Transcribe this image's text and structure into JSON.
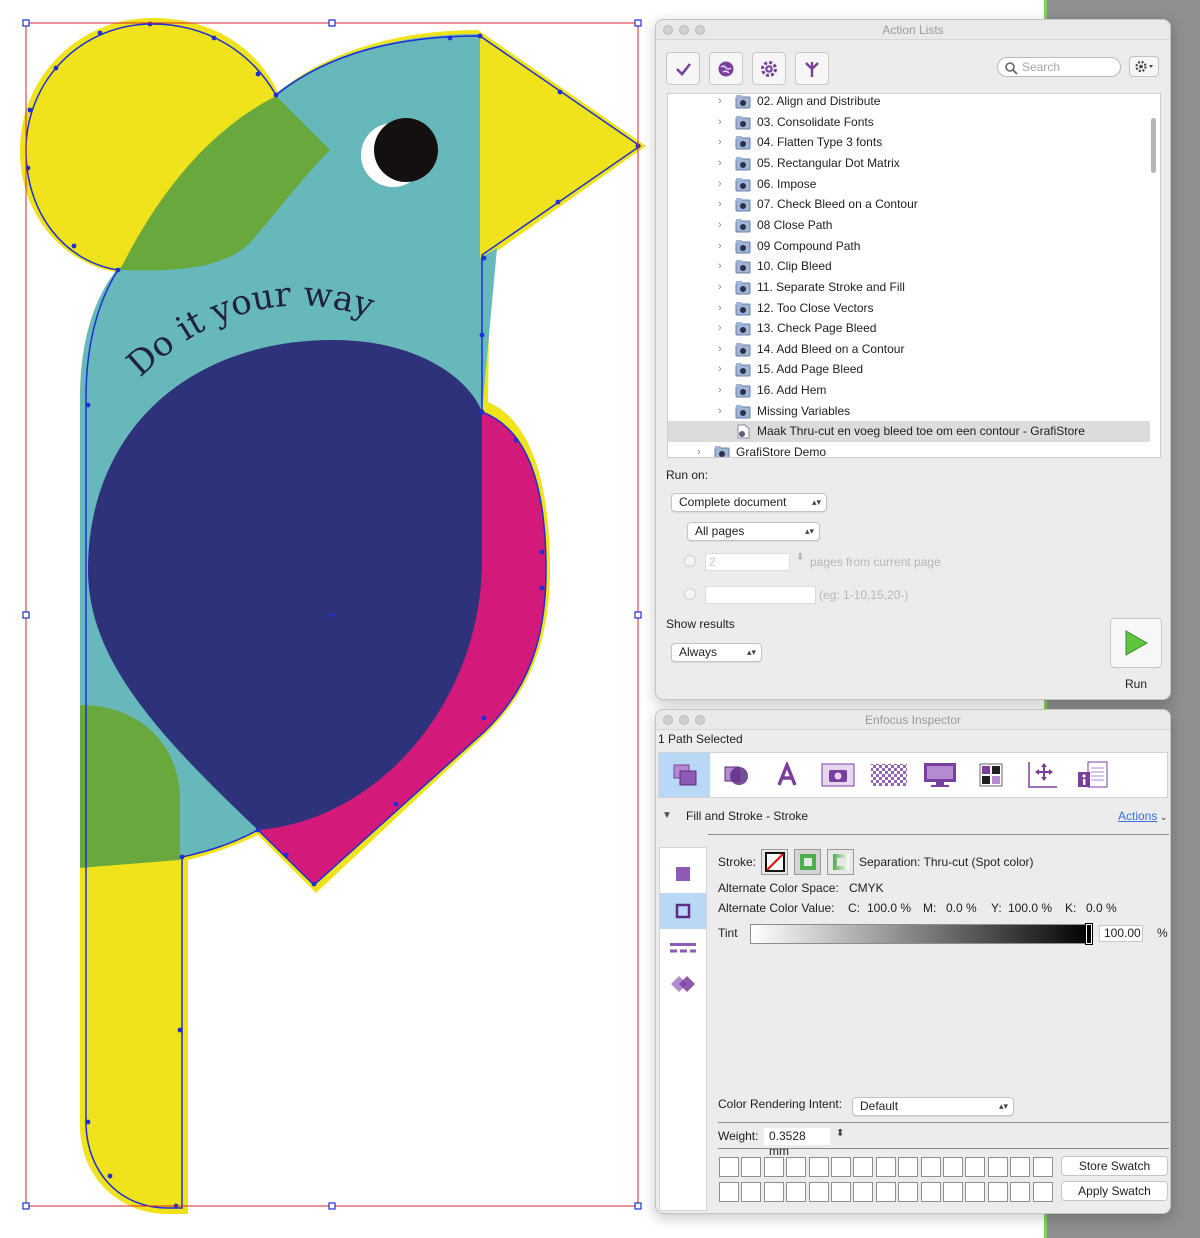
{
  "artwork": {
    "headline": "Do it your way",
    "colors": {
      "teal": "#67b8bb",
      "yellow": "#f0e31b",
      "green": "#68a83c",
      "navy": "#2d327a",
      "magenta": "#d31a7a",
      "selection_path": "#1d2fd6",
      "trim_box": "#d3262f"
    }
  },
  "action_lists": {
    "window_title": "Action Lists",
    "toolbar": {
      "buttons": [
        {
          "icon": "check-icon"
        },
        {
          "icon": "globe-icon"
        },
        {
          "icon": "gear-icon"
        },
        {
          "icon": "split-arrow-icon"
        }
      ],
      "search_placeholder": "Search",
      "options_icon": "gear-menu-icon"
    },
    "items": [
      {
        "label": "02. Align and Distribute"
      },
      {
        "label": "03. Consolidate Fonts"
      },
      {
        "label": "04. Flatten Type 3 fonts"
      },
      {
        "label": "05. Rectangular Dot Matrix"
      },
      {
        "label": "06. Impose"
      },
      {
        "label": "07. Check Bleed on a Contour"
      },
      {
        "label": "08 Close Path"
      },
      {
        "label": "09 Compound Path"
      },
      {
        "label": "10. Clip Bleed"
      },
      {
        "label": "11. Separate Stroke and Fill"
      },
      {
        "label": "12. Too Close Vectors"
      },
      {
        "label": "13. Check Page Bleed"
      },
      {
        "label": "14. Add Bleed on a Contour"
      },
      {
        "label": "15. Add Page Bleed"
      },
      {
        "label": "16. Add Hem"
      },
      {
        "label": "Missing Variables"
      }
    ],
    "selected_item": "Maak Thru-cut en voeg bleed toe om een contour - GrafiStore",
    "parent_folder": "GrafiStore Demo",
    "run_on_label": "Run on:",
    "run_on_value": "Complete document",
    "pages_value": "All pages",
    "pages_count": "2",
    "pages_from_current": "pages from current page",
    "page_range_hint": "(eg: 1-10,15,20-)",
    "show_results_label": "Show results",
    "show_results_value": "Always",
    "run_label": "Run"
  },
  "inspector": {
    "window_title": "Enfocus Inspector",
    "selection_status": "1 Path Selected",
    "tab_icons": [
      "fill-stroke-icon",
      "transparency-icon",
      "text-icon",
      "image-icon",
      "pattern-icon",
      "monitor-icon",
      "swatch-grid-icon",
      "position-icon",
      "document-info-icon"
    ],
    "section_title": "Fill and Stroke - Stroke",
    "actions_label": "Actions",
    "stroke_label": "Stroke:",
    "separation": "Separation: Thru-cut (Spot color)",
    "alt_space_label": "Alternate Color Space:",
    "alt_space_value": "CMYK",
    "alt_value_label": "Alternate Color Value:",
    "cmyk": {
      "c_label": "C:",
      "c": "100.0 %",
      "m_label": "M:",
      "m": "0.0 %",
      "y_label": "Y:",
      "y": "100.0 %",
      "k_label": "K:",
      "k": "0.0 %"
    },
    "tint_label": "Tint",
    "tint_value": "100.00",
    "tint_unit": "%",
    "tint_level": 1.0,
    "rendering_intent_label": "Color Rendering Intent:",
    "rendering_intent_value": "Default",
    "weight_label": "Weight:",
    "weight_value": "0.3528 mm",
    "store_swatch": "Store Swatch",
    "apply_swatch": "Apply Swatch"
  }
}
